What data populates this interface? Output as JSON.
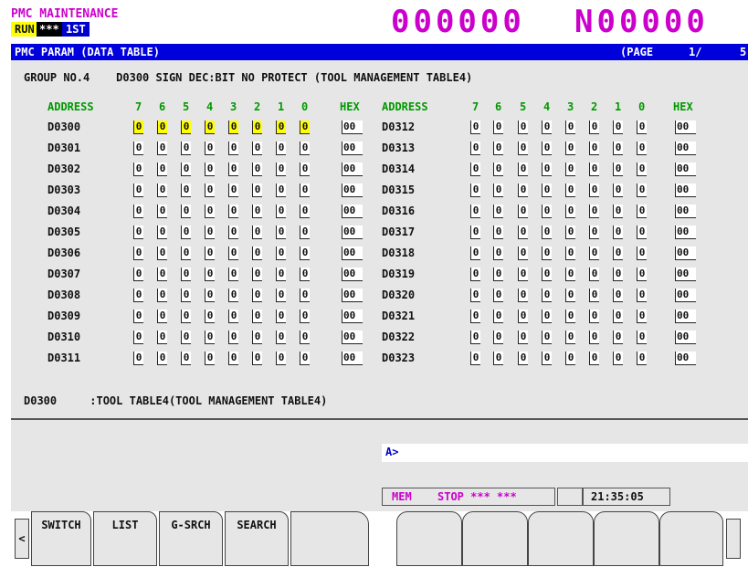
{
  "header": {
    "title": "PMC MAINTENANCE",
    "mode_run": "RUN",
    "mode_alarm": "***",
    "mode_pmc": "1ST PMC",
    "o_number": "000000",
    "n_number": "N00000"
  },
  "title_bar": {
    "label": "PMC PARAM (DATA TABLE)",
    "page_label": "(PAGE",
    "page_current": "1/",
    "page_total": "5)"
  },
  "group_line": "GROUP NO.4    D0300 SIGN DEC:BIT NO PROTECT (TOOL MANAGEMENT TABLE4)",
  "columns": {
    "address": "ADDRESS",
    "bits": [
      "7",
      "6",
      "5",
      "4",
      "3",
      "2",
      "1",
      "0"
    ],
    "hex": "HEX"
  },
  "left_rows": [
    {
      "addr": "D0300",
      "bits": [
        "0",
        "0",
        "0",
        "0",
        "0",
        "0",
        "0",
        "0"
      ],
      "hex": "00"
    },
    {
      "addr": "D0301",
      "bits": [
        "0",
        "0",
        "0",
        "0",
        "0",
        "0",
        "0",
        "0"
      ],
      "hex": "00"
    },
    {
      "addr": "D0302",
      "bits": [
        "0",
        "0",
        "0",
        "0",
        "0",
        "0",
        "0",
        "0"
      ],
      "hex": "00"
    },
    {
      "addr": "D0303",
      "bits": [
        "0",
        "0",
        "0",
        "0",
        "0",
        "0",
        "0",
        "0"
      ],
      "hex": "00"
    },
    {
      "addr": "D0304",
      "bits": [
        "0",
        "0",
        "0",
        "0",
        "0",
        "0",
        "0",
        "0"
      ],
      "hex": "00"
    },
    {
      "addr": "D0305",
      "bits": [
        "0",
        "0",
        "0",
        "0",
        "0",
        "0",
        "0",
        "0"
      ],
      "hex": "00"
    },
    {
      "addr": "D0306",
      "bits": [
        "0",
        "0",
        "0",
        "0",
        "0",
        "0",
        "0",
        "0"
      ],
      "hex": "00"
    },
    {
      "addr": "D0307",
      "bits": [
        "0",
        "0",
        "0",
        "0",
        "0",
        "0",
        "0",
        "0"
      ],
      "hex": "00"
    },
    {
      "addr": "D0308",
      "bits": [
        "0",
        "0",
        "0",
        "0",
        "0",
        "0",
        "0",
        "0"
      ],
      "hex": "00"
    },
    {
      "addr": "D0309",
      "bits": [
        "0",
        "0",
        "0",
        "0",
        "0",
        "0",
        "0",
        "0"
      ],
      "hex": "00"
    },
    {
      "addr": "D0310",
      "bits": [
        "0",
        "0",
        "0",
        "0",
        "0",
        "0",
        "0",
        "0"
      ],
      "hex": "00"
    },
    {
      "addr": "D0311",
      "bits": [
        "0",
        "0",
        "0",
        "0",
        "0",
        "0",
        "0",
        "0"
      ],
      "hex": "00"
    }
  ],
  "right_rows": [
    {
      "addr": "D0312",
      "bits": [
        "0",
        "0",
        "0",
        "0",
        "0",
        "0",
        "0",
        "0"
      ],
      "hex": "00"
    },
    {
      "addr": "D0313",
      "bits": [
        "0",
        "0",
        "0",
        "0",
        "0",
        "0",
        "0",
        "0"
      ],
      "hex": "00"
    },
    {
      "addr": "D0314",
      "bits": [
        "0",
        "0",
        "0",
        "0",
        "0",
        "0",
        "0",
        "0"
      ],
      "hex": "00"
    },
    {
      "addr": "D0315",
      "bits": [
        "0",
        "0",
        "0",
        "0",
        "0",
        "0",
        "0",
        "0"
      ],
      "hex": "00"
    },
    {
      "addr": "D0316",
      "bits": [
        "0",
        "0",
        "0",
        "0",
        "0",
        "0",
        "0",
        "0"
      ],
      "hex": "00"
    },
    {
      "addr": "D0317",
      "bits": [
        "0",
        "0",
        "0",
        "0",
        "0",
        "0",
        "0",
        "0"
      ],
      "hex": "00"
    },
    {
      "addr": "D0318",
      "bits": [
        "0",
        "0",
        "0",
        "0",
        "0",
        "0",
        "0",
        "0"
      ],
      "hex": "00"
    },
    {
      "addr": "D0319",
      "bits": [
        "0",
        "0",
        "0",
        "0",
        "0",
        "0",
        "0",
        "0"
      ],
      "hex": "00"
    },
    {
      "addr": "D0320",
      "bits": [
        "0",
        "0",
        "0",
        "0",
        "0",
        "0",
        "0",
        "0"
      ],
      "hex": "00"
    },
    {
      "addr": "D0321",
      "bits": [
        "0",
        "0",
        "0",
        "0",
        "0",
        "0",
        "0",
        "0"
      ],
      "hex": "00"
    },
    {
      "addr": "D0322",
      "bits": [
        "0",
        "0",
        "0",
        "0",
        "0",
        "0",
        "0",
        "0"
      ],
      "hex": "00"
    },
    {
      "addr": "D0323",
      "bits": [
        "0",
        "0",
        "0",
        "0",
        "0",
        "0",
        "0",
        "0"
      ],
      "hex": "00"
    }
  ],
  "selected_row_address": "D0300",
  "comment_line": "D0300     :TOOL TABLE4(TOOL MANAGEMENT TABLE4)",
  "input_prompt": "A>",
  "status": {
    "mode": "MEM",
    "state": "STOP *** ***",
    "time": "21:35:05"
  },
  "softkeys": {
    "prev": "<",
    "switch": "SWITCH",
    "list": "LIST",
    "gsrch": "G-SRCH",
    "search": "SEARCH"
  },
  "colors": {
    "magenta": "#cc00cc",
    "title_bar_blue": "#0000dd",
    "column_green": "#009900",
    "highlight_yellow": "#ffff00",
    "panel_gray": "#e6e6e6"
  }
}
